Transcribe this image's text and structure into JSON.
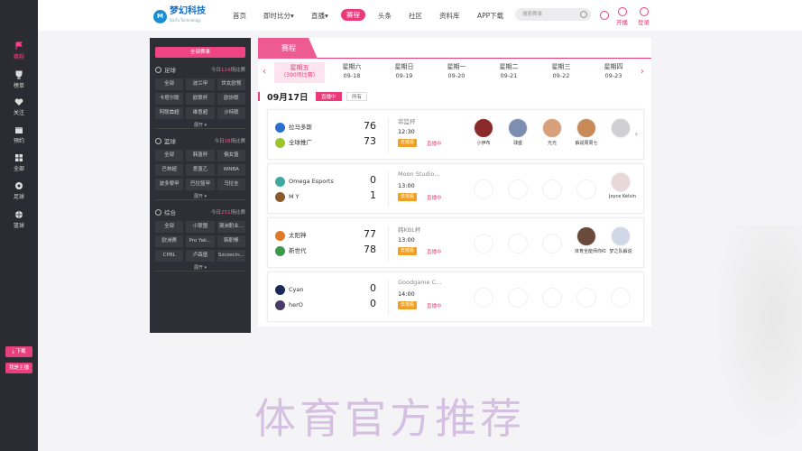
{
  "sidebar": {
    "items": [
      {
        "label": "赛程",
        "icon": "flag-icon",
        "active": true
      },
      {
        "label": "榜单",
        "icon": "trophy-icon"
      },
      {
        "label": "关注",
        "icon": "heart-icon"
      },
      {
        "label": "预约",
        "icon": "calendar-icon"
      },
      {
        "label": "全部",
        "icon": "grid-icon"
      },
      {
        "label": "足球",
        "icon": "football-icon"
      },
      {
        "label": "篮球",
        "icon": "basketball-icon"
      }
    ],
    "download_label": "下载",
    "anchor_label": "我是主播"
  },
  "nav": {
    "logo_text": "梦幻科技",
    "logo_sub": "DaiTu Technology",
    "logo_badge": "M",
    "links": [
      "首页",
      "即时比分▾",
      "直播▾",
      "赛程",
      "头条",
      "社区",
      "资料库",
      "APP下载"
    ],
    "search_placeholder": "搜索赛事",
    "open_live": "开播",
    "login": "登录"
  },
  "panel": {
    "all_button": "全部赛事",
    "expand_label": "展开 ▾",
    "sections": [
      {
        "title": "足球",
        "count_prefix": "今日",
        "count": "124",
        "count_suffix": "场比赛",
        "tags": [
          "全部",
          "波兰甲",
          "世女欧预",
          "卡塔尔联",
          "欧联杯",
          "欧协联",
          "阿联酋超",
          "维意超",
          "沙特联"
        ]
      },
      {
        "title": "篮球",
        "count_prefix": "今日",
        "count": "16",
        "count_suffix": "场比赛",
        "tags": [
          "全部",
          "韩篮杯",
          "俄女篮",
          "巴林超",
          "意篮乙",
          "WNBA",
          "波多黎甲",
          "巴拉篮甲",
          "乌拉圭"
        ]
      },
      {
        "title": "综合",
        "count_prefix": "今日",
        "count": "251",
        "count_suffix": "场比赛",
        "tags": [
          "全部",
          "小联盟",
          "澳洲职业...",
          "欧洲赛",
          "Pro Yak...",
          "韩职棒",
          "CPBL",
          "卢森堡",
          "Szczecin..."
        ]
      }
    ]
  },
  "schedule": {
    "tab_label": "赛程",
    "days": [
      {
        "weekday": "星期五",
        "date": "(390场比赛)",
        "active": true
      },
      {
        "weekday": "星期六",
        "date": "09-18"
      },
      {
        "weekday": "星期日",
        "date": "09-19"
      },
      {
        "weekday": "星期一",
        "date": "09-20"
      },
      {
        "weekday": "星期二",
        "date": "09-21"
      },
      {
        "weekday": "星期三",
        "date": "09-22"
      },
      {
        "weekday": "星期四",
        "date": "09-23"
      }
    ],
    "current_date": "09月17日",
    "filter_live": "直播中",
    "filter_all": "所有",
    "go_watch": "去观看",
    "live_label": "直播中",
    "matches": [
      {
        "home": "拉马多斯",
        "away": "全球推广",
        "home_score": "76",
        "away_score": "73",
        "league": "菲篮杯",
        "time": "12:30",
        "home_color": "#2a6fd0",
        "away_color": "#9ac62b",
        "anchors": [
          {
            "name": "小伊布",
            "color": "#8a2a2a"
          },
          {
            "name": "球盛",
            "color": "#7d8fb0"
          },
          {
            "name": "光光",
            "color": "#d8a07a"
          },
          {
            "name": "解说周周七",
            "color": "#c98a5a"
          },
          {
            "name": "",
            "color": "#cfcfd4"
          }
        ]
      },
      {
        "home": "Omega Esports",
        "away": "M Y",
        "home_score": "0",
        "away_score": "1",
        "league": "Moon Studio...",
        "time": "13:00",
        "home_color": "#3fa8a0",
        "away_color": "#8b5a2b",
        "anchors": [
          {
            "name": "Joyce Kelvin",
            "color": "#e8d8d8"
          }
        ]
      },
      {
        "home": "太阳神",
        "away": "新世代",
        "home_score": "77",
        "away_score": "78",
        "league": "韩KBL杯",
        "time": "13:00",
        "home_color": "#e07a2a",
        "away_color": "#3a9a4a",
        "anchors": [
          {
            "name": "体育全能师你红",
            "color": "#6a4a3a"
          },
          {
            "name": "梦之队解说",
            "color": "#d0d8e8"
          }
        ]
      },
      {
        "home": "Cyan",
        "away": "herO",
        "home_score": "0",
        "away_score": "0",
        "league": "Goodgame C...",
        "time": "14:00",
        "home_color": "#1a2a5a",
        "away_color": "#4a3a6a",
        "anchors": []
      }
    ]
  },
  "watermark": "体育官方推荐",
  "colors": {
    "accent": "#ea3a79",
    "sidebar": "#2b2b33",
    "panel": "#2e2e36",
    "go_button": "#f0a024"
  }
}
